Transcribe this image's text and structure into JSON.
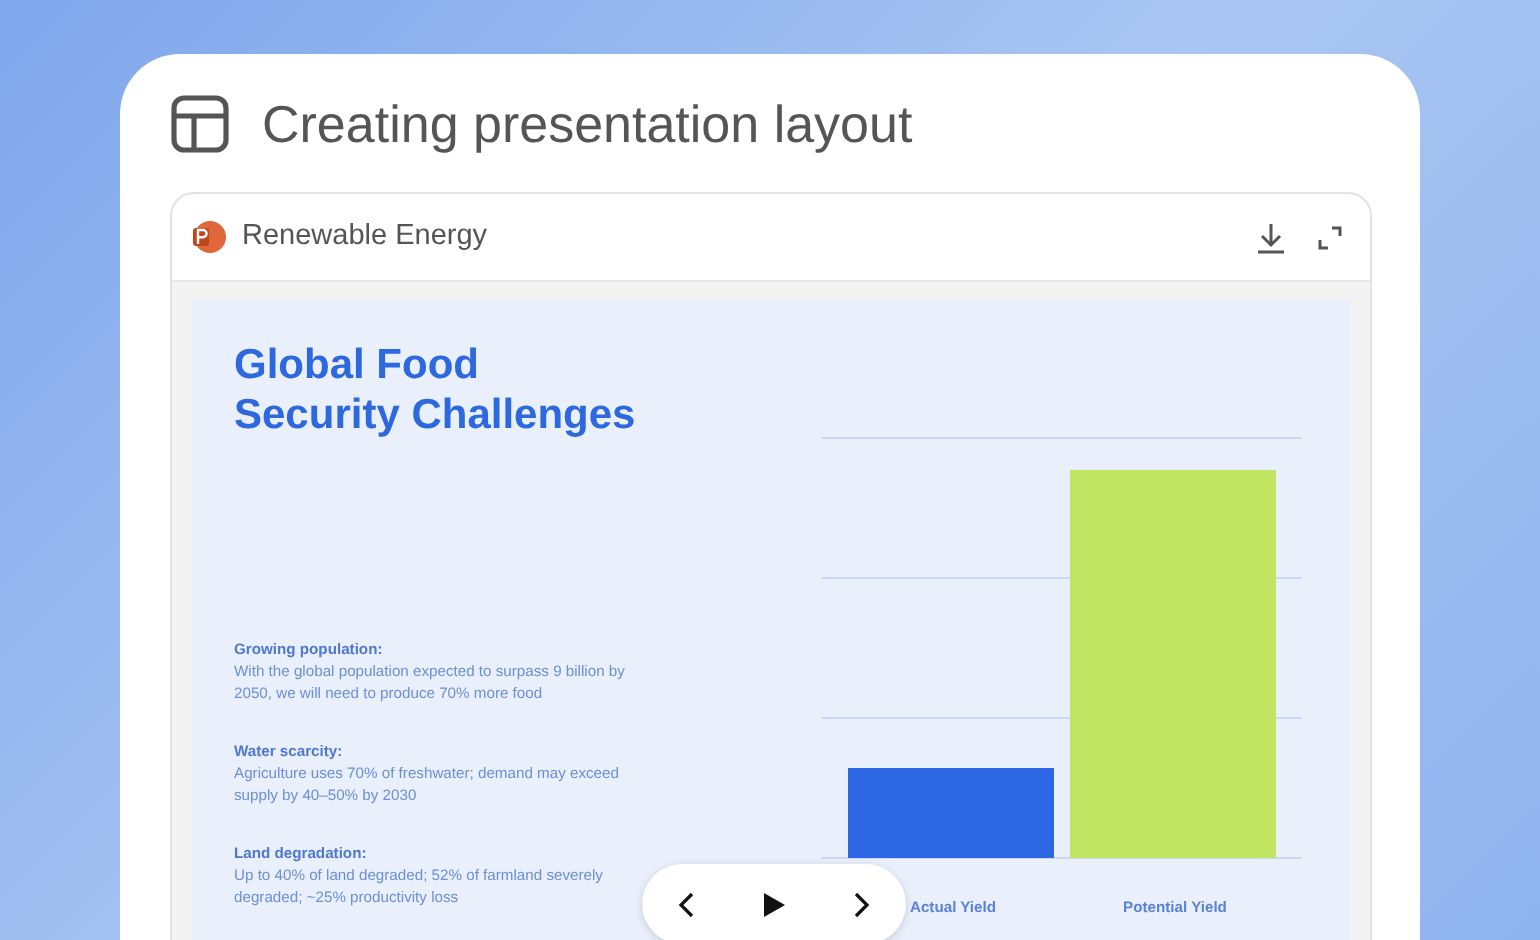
{
  "panel": {
    "title": "Creating presentation layout"
  },
  "file": {
    "name": "Renewable Energy"
  },
  "slide": {
    "title_lines": [
      "Global Food",
      "Security Challenges"
    ],
    "points": [
      {
        "heading": "Growing population:",
        "text": "With the global population expected to surpass 9 billion by 2050, we will need to produce 70% more food"
      },
      {
        "heading": "Water scarcity:",
        "text": "Agriculture uses 70% of freshwater; demand may exceed supply by 40–50% by 2030"
      },
      {
        "heading": "Land degradation:",
        "text": "Up to 40% of land degraded; 52% of farmland severely degraded; ~25% productivity loss"
      }
    ],
    "chart_categories": [
      "Actual Yield",
      "Potential Yield"
    ]
  }
}
